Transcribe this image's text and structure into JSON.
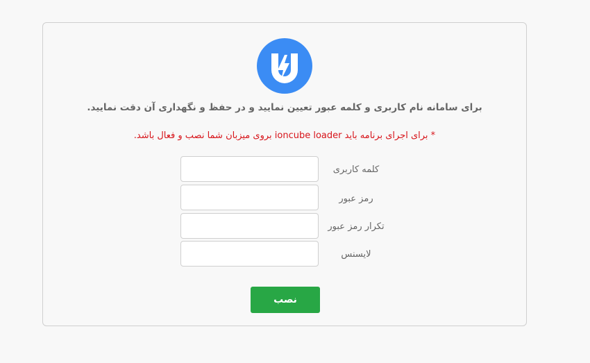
{
  "logo": {
    "icon": "ioncube-u-bolt-icon",
    "color": "#3b8cf4"
  },
  "header": {
    "instruction": "برای سامانه نام کاربری و کلمه عبور تعیین نمایید و در حفظ و نگهداری آن دقت نمایید."
  },
  "notice": {
    "prefix": "* برای اجرای برنامه باید",
    "highlight": "ioncube loader",
    "suffix": "بروی میزبان شما نصب و فعال باشد."
  },
  "form": {
    "username_label": "کلمه کاربری",
    "username_value": "",
    "password_label": "رمز عبور",
    "password_value": "",
    "password_repeat_label": "تکرار رمز عبور",
    "password_repeat_value": "",
    "license_label": "لایسنس",
    "license_value": "",
    "submit_label": "نصب"
  },
  "colors": {
    "accent": "#3b8cf4",
    "submit": "#28a745",
    "warning": "#d7141a"
  }
}
